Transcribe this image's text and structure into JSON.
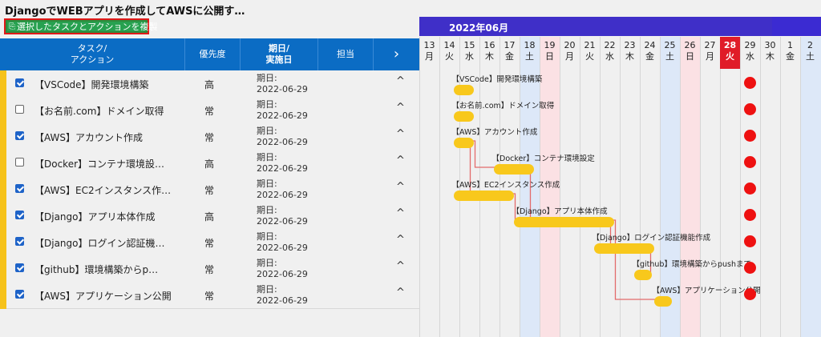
{
  "page": {
    "title": "DjangoでWEBアプリを作成してAWSに公開す…"
  },
  "toolbar": {
    "copy_label": "選択したタスクとアクションを複製",
    "copy_icon": "copy-icon"
  },
  "header": {
    "task": "タスク/\nアクション",
    "priority": "優先度",
    "due": "期日/\n実施日",
    "owner": "担当",
    "expand": "›"
  },
  "tasks": [
    {
      "name": "【VSCode】開発環境構築",
      "checked": true,
      "priority": "高",
      "due_label": "期日:",
      "due": "2022-06-29",
      "caret": "^"
    },
    {
      "name": "【お名前.com】ドメイン取得",
      "checked": false,
      "priority": "常",
      "due_label": "期日:",
      "due": "2022-06-29",
      "caret": "^"
    },
    {
      "name": "【AWS】アカウント作成",
      "checked": true,
      "priority": "常",
      "due_label": "期日:",
      "due": "2022-06-29",
      "caret": "^"
    },
    {
      "name": "【Docker】コンテナ環境設…",
      "checked": false,
      "priority": "高",
      "due_label": "期日:",
      "due": "2022-06-29",
      "caret": "^"
    },
    {
      "name": "【AWS】EC2インスタンス作…",
      "checked": true,
      "priority": "常",
      "due_label": "期日:",
      "due": "2022-06-29",
      "caret": "^"
    },
    {
      "name": "【Django】アプリ本体作成",
      "checked": true,
      "priority": "高",
      "due_label": "期日:",
      "due": "2022-06-29",
      "caret": "^"
    },
    {
      "name": "【Django】ログイン認証機…",
      "checked": true,
      "priority": "常",
      "due_label": "期日:",
      "due": "2022-06-29",
      "caret": "^"
    },
    {
      "name": "【github】環境構築からp…",
      "checked": true,
      "priority": "常",
      "due_label": "期日:",
      "due": "2022-06-29",
      "caret": "^"
    },
    {
      "name": "【AWS】アプリケーション公開",
      "checked": true,
      "priority": "常",
      "due_label": "期日:",
      "due": "2022-06-29",
      "caret": "^"
    }
  ],
  "gantt": {
    "month": "2022年06月",
    "today_index": 15,
    "days": [
      {
        "d": "13",
        "w": "月",
        "type": "weekday"
      },
      {
        "d": "14",
        "w": "火",
        "type": "weekday"
      },
      {
        "d": "15",
        "w": "水",
        "type": "weekday"
      },
      {
        "d": "16",
        "w": "木",
        "type": "weekday"
      },
      {
        "d": "17",
        "w": "金",
        "type": "weekday"
      },
      {
        "d": "18",
        "w": "土",
        "type": "sat"
      },
      {
        "d": "19",
        "w": "日",
        "type": "sun"
      },
      {
        "d": "20",
        "w": "月",
        "type": "weekday"
      },
      {
        "d": "21",
        "w": "火",
        "type": "weekday"
      },
      {
        "d": "22",
        "w": "水",
        "type": "weekday"
      },
      {
        "d": "23",
        "w": "木",
        "type": "weekday"
      },
      {
        "d": "24",
        "w": "金",
        "type": "weekday"
      },
      {
        "d": "25",
        "w": "土",
        "type": "sat"
      },
      {
        "d": "26",
        "w": "日",
        "type": "sun"
      },
      {
        "d": "27",
        "w": "月",
        "type": "weekday"
      },
      {
        "d": "28",
        "w": "火",
        "type": "today"
      },
      {
        "d": "29",
        "w": "水",
        "type": "weekday"
      },
      {
        "d": "30",
        "w": "木",
        "type": "weekday"
      },
      {
        "d": "1",
        "w": "金",
        "type": "weekday"
      },
      {
        "d": "2",
        "w": "土",
        "type": "sat"
      }
    ],
    "bars": [
      {
        "label": "【VSCode】開発環境構築",
        "start": 1.7,
        "end": 2.7
      },
      {
        "label": "【お名前.com】ドメイン取得",
        "start": 1.7,
        "end": 2.7
      },
      {
        "label": "【AWS】アカウント作成",
        "start": 1.7,
        "end": 2.7
      },
      {
        "label": "【Docker】コンテナ環境設定",
        "start": 3.7,
        "end": 5.7
      },
      {
        "label": "【AWS】EC2インスタンス作成",
        "start": 1.7,
        "end": 4.7
      },
      {
        "label": "【Django】アプリ本体作成",
        "start": 4.7,
        "end": 9.7
      },
      {
        "label": "【Django】ログイン認証機能作成",
        "start": 8.7,
        "end": 11.7
      },
      {
        "label": "【github】環境構築からpushまで",
        "start": 10.7,
        "end": 11.6
      },
      {
        "label": "【AWS】アプリケーション公開",
        "start": 11.7,
        "end": 12.6
      }
    ],
    "deadline_index": 16,
    "colors": {
      "sat": "#dde8f8",
      "sun": "#fbe1e4",
      "today": "#e01c28",
      "bar": "#f8c81c",
      "deadline": "#ee1111",
      "link": "#e36b6b"
    }
  }
}
